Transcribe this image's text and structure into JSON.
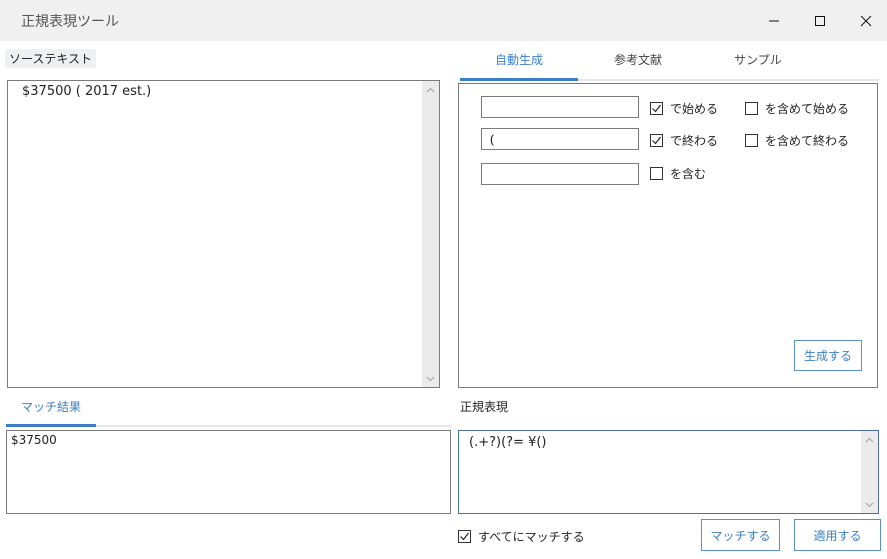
{
  "window": {
    "title": "正規表現ツール",
    "controls": {
      "minimize": "minimize-icon",
      "maximize": "maximize-icon",
      "close": "close-icon"
    }
  },
  "source": {
    "label": "ソーステキスト",
    "text": "$37500 ( 2017 est.)"
  },
  "tabs": [
    {
      "label": "自動生成",
      "active": true
    },
    {
      "label": "参考文献",
      "active": false
    },
    {
      "label": "サンプル",
      "active": false
    }
  ],
  "auto_generate": {
    "rows": [
      {
        "input_value": "",
        "option": {
          "label": "で始める",
          "checked": true
        },
        "include_option": {
          "label": "を含めて始める",
          "checked": false
        }
      },
      {
        "input_value": "(",
        "option": {
          "label": "で終わる",
          "checked": true
        },
        "include_option": {
          "label": "を含めて終わる",
          "checked": false
        }
      },
      {
        "input_value": "",
        "option": {
          "label": "を含む",
          "checked": false
        }
      }
    ],
    "generate_button": "生成する"
  },
  "match_result": {
    "tab_label": "マッチ結果",
    "text": "$37500"
  },
  "regex": {
    "label": "正規表現",
    "value": "(.+?)(?= ¥()"
  },
  "footer": {
    "match_all": {
      "label": "すべてにマッチする",
      "checked": true
    },
    "match_button": "マッチする",
    "apply_button": "適用する"
  },
  "colors": {
    "accent": "#3b7fc4",
    "border": "#7a7a7a",
    "titlebar": "#f0f0f0",
    "scrollbar": "#ebebeb"
  }
}
